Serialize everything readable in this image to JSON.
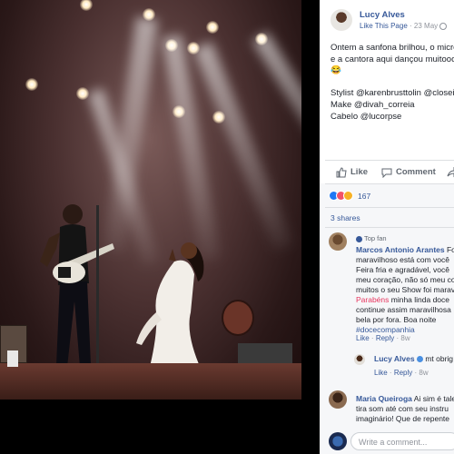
{
  "post": {
    "page_name": "Lucy Alves",
    "like_page": "Like This Page",
    "separator": "·",
    "date": "23 May",
    "text_line1": "Ontem a sanfona brilhou, o micro",
    "text_line2": "e a cantora aqui dançou muitooo",
    "emoji": "😂",
    "credit_stylist": "Stylist @karenbrusttolin @closei",
    "credit_make": "Make @divah_correia",
    "credit_hair": "Cabelo @lucorpse"
  },
  "actions": {
    "like": "Like",
    "comment": "Comment"
  },
  "reactions": {
    "count": "167",
    "shares": "3 shares"
  },
  "comments": [
    {
      "badge": "Top fan",
      "author": "Marcos Antonio Arantes",
      "lines": [
        "Fo",
        "maravilhoso está com você",
        "Feira fria e agradável, você",
        "meu coração, não só meu co",
        "muitos o seu Show foi marav"
      ],
      "highlight": "Parabéns",
      "line_after_hl": " minha linda doce",
      "lines2": [
        "continue assim maravilhosa",
        "bela por fora. Boa noite"
      ],
      "hashtag": "#docecompanhia",
      "like": "Like",
      "reply": "Reply",
      "time": "8w"
    },
    {
      "author": "Lucy Alves",
      "text": "mt obrig",
      "like": "Like",
      "reply": "Reply",
      "time": "8w"
    },
    {
      "author": "Maria Queiroga",
      "lines": [
        "Ai sim é tale",
        "tira som até com seu instru",
        "imaginário! Que de repente"
      ]
    }
  ],
  "composer": {
    "placeholder": "Write a comment..."
  },
  "colors": {
    "link": "#365899",
    "highlight": "#e7365f",
    "like_reaction": "#2078f4",
    "love_reaction": "#f25268",
    "haha_reaction": "#f7b125"
  }
}
